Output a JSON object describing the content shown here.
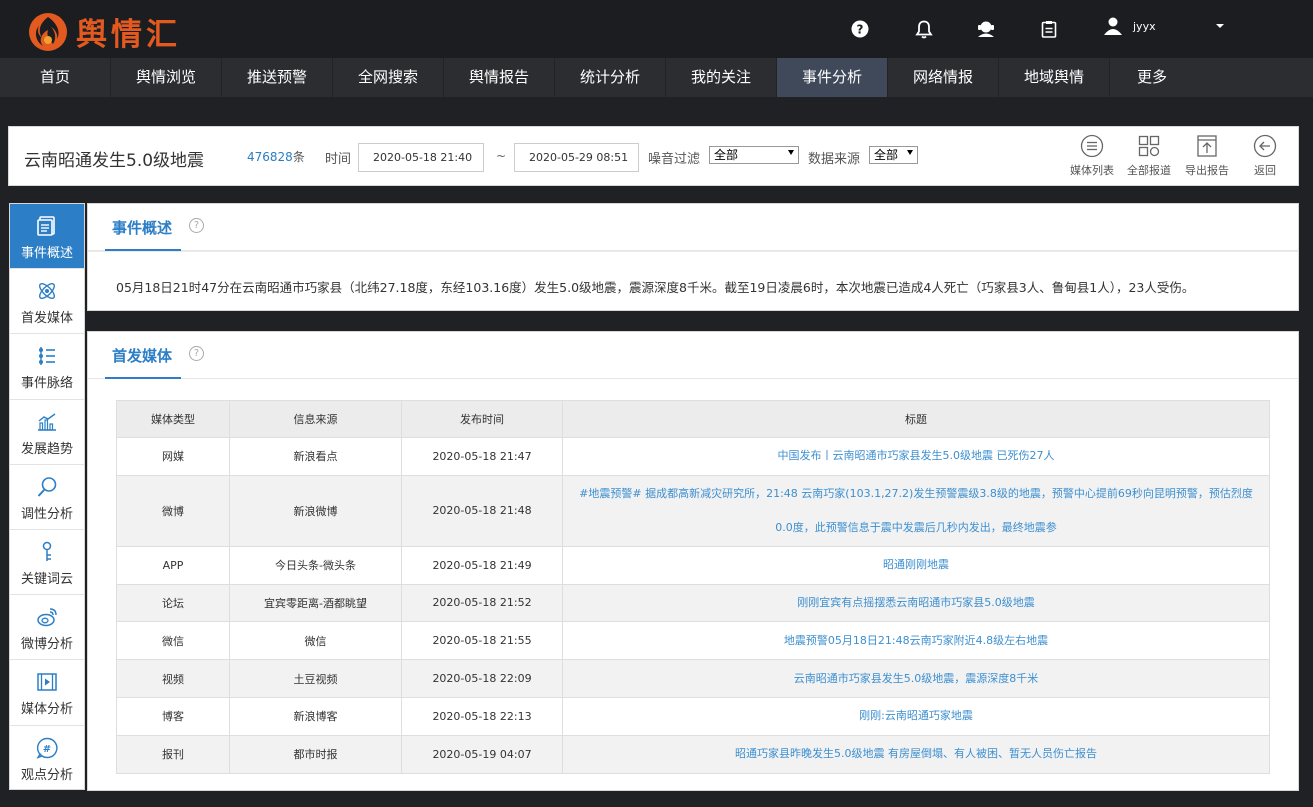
{
  "brand": {
    "name": "舆情汇"
  },
  "header": {
    "icons": [
      "help-icon",
      "bell-icon",
      "support-icon",
      "clipboard-icon"
    ],
    "user": {
      "name": "jyyx"
    }
  },
  "nav": {
    "items": [
      {
        "label": "首页"
      },
      {
        "label": "舆情浏览"
      },
      {
        "label": "推送预警"
      },
      {
        "label": "全网搜索"
      },
      {
        "label": "舆情报告"
      },
      {
        "label": "统计分析"
      },
      {
        "label": "我的关注"
      },
      {
        "label": "事件分析",
        "active": true
      },
      {
        "label": "网络情报"
      },
      {
        "label": "地域舆情"
      },
      {
        "label": "更多"
      }
    ]
  },
  "filter": {
    "event_title": "云南昭通发生5.0级地震",
    "count": "476828",
    "count_unit": "条",
    "time_label": "时间",
    "start_time": "2020-05-18 21:40",
    "separator": "~",
    "end_time": "2020-05-29 08:51",
    "noise_label": "噪音过滤",
    "noise_value": "全部",
    "source_label": "数据来源",
    "source_value": "全部",
    "tools": [
      {
        "label": "媒体列表",
        "icon": "list-icon"
      },
      {
        "label": "全部报道",
        "icon": "grid-icon"
      },
      {
        "label": "导出报告",
        "icon": "export-icon"
      },
      {
        "label": "返回",
        "icon": "back-icon"
      }
    ]
  },
  "sidebar": {
    "items": [
      {
        "label": "事件概述",
        "icon": "document-icon",
        "active": true
      },
      {
        "label": "首发媒体",
        "icon": "atom-icon"
      },
      {
        "label": "事件脉络",
        "icon": "timeline-icon"
      },
      {
        "label": "发展趋势",
        "icon": "trend-chart-icon"
      },
      {
        "label": "调性分析",
        "icon": "magnifier-icon"
      },
      {
        "label": "关键词云",
        "icon": "key-icon"
      },
      {
        "label": "微博分析",
        "icon": "weibo-icon"
      },
      {
        "label": "媒体分析",
        "icon": "film-icon"
      },
      {
        "label": "观点分析",
        "icon": "hashtag-icon"
      }
    ]
  },
  "overview": {
    "title": "事件概述",
    "help": "?",
    "text": "05月18日21时47分在云南昭通市巧家县（北纬27.18度，东经103.16度）发生5.0级地震，震源深度8千米。截至19日凌晨6时，本次地震已造成4人死亡（巧家县3人、鲁甸县1人），23人受伤。"
  },
  "first_media": {
    "title": "首发媒体",
    "help": "?",
    "columns": [
      "媒体类型",
      "信息来源",
      "发布时间",
      "标题"
    ],
    "rows": [
      {
        "type": "网媒",
        "source": "新浪看点",
        "time": "2020-05-18 21:47",
        "title": "中国发布丨云南昭通市巧家县发生5.0级地震 已死伤27人"
      },
      {
        "type": "微博",
        "source": "新浪微博",
        "time": "2020-05-18 21:48",
        "title": "#地震预警# 据成都高新减灾研究所，21:48 云南巧家(103.1,27.2)发生预警震级3.8级的地震，预警中心提前69秒向昆明预警，预估烈度0.0度，此预警信息于震中发震后几秒内发出，最终地震参"
      },
      {
        "type": "APP",
        "source": "今日头条-微头条",
        "time": "2020-05-18 21:49",
        "title": "昭通刚刚地震"
      },
      {
        "type": "论坛",
        "source": "宜宾零距离-酒都眺望",
        "time": "2020-05-18 21:52",
        "title": "刚刚宜宾有点摇摆悉云南昭通市巧家县5.0级地震"
      },
      {
        "type": "微信",
        "source": "微信",
        "time": "2020-05-18 21:55",
        "title": "地震预警05月18日21:48云南巧家附近4.8级左右地震"
      },
      {
        "type": "视频",
        "source": "土豆视频",
        "time": "2020-05-18 22:09",
        "title": "云南昭通市巧家县发生5.0级地震，震源深度8千米"
      },
      {
        "type": "博客",
        "source": "新浪博客",
        "time": "2020-05-18 22:13",
        "title": "刚刚:云南昭通巧家地震"
      },
      {
        "type": "报刊",
        "source": "都市时报",
        "time": "2020-05-19 04:07",
        "title": "昭通巧家县昨晚发生5.0级地震 有房屋倒塌、有人被困、暂无人员伤亡报告"
      }
    ]
  },
  "colors": {
    "accent": "#2c7ec6",
    "brand": "#e25a1f",
    "link": "#3d8fd0"
  }
}
